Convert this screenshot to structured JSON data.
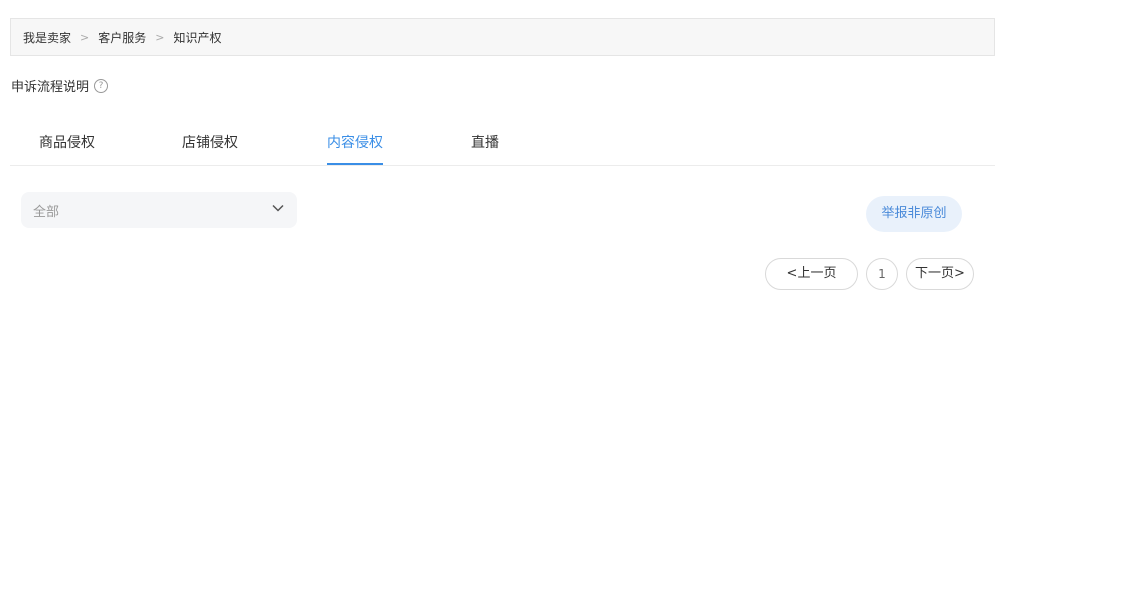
{
  "breadcrumb": {
    "items": [
      "我是卖家",
      "客户服务",
      "知识产权"
    ],
    "separator": ">"
  },
  "process": {
    "label": "申诉流程说明",
    "help_glyph": "?"
  },
  "tabs": [
    {
      "label": "商品侵权",
      "active": false
    },
    {
      "label": "店铺侵权",
      "active": false
    },
    {
      "label": "内容侵权",
      "active": true
    },
    {
      "label": "直播",
      "active": false
    }
  ],
  "filter": {
    "selected": "全部"
  },
  "actions": {
    "report_label": "举报非原创"
  },
  "pagination": {
    "prev_label": "<上一页",
    "current_page": "1",
    "next_label": "下一页>"
  },
  "colors": {
    "accent": "#3a8ee6",
    "report_bg": "#e9f1fb",
    "report_text": "#4a8ad9"
  }
}
